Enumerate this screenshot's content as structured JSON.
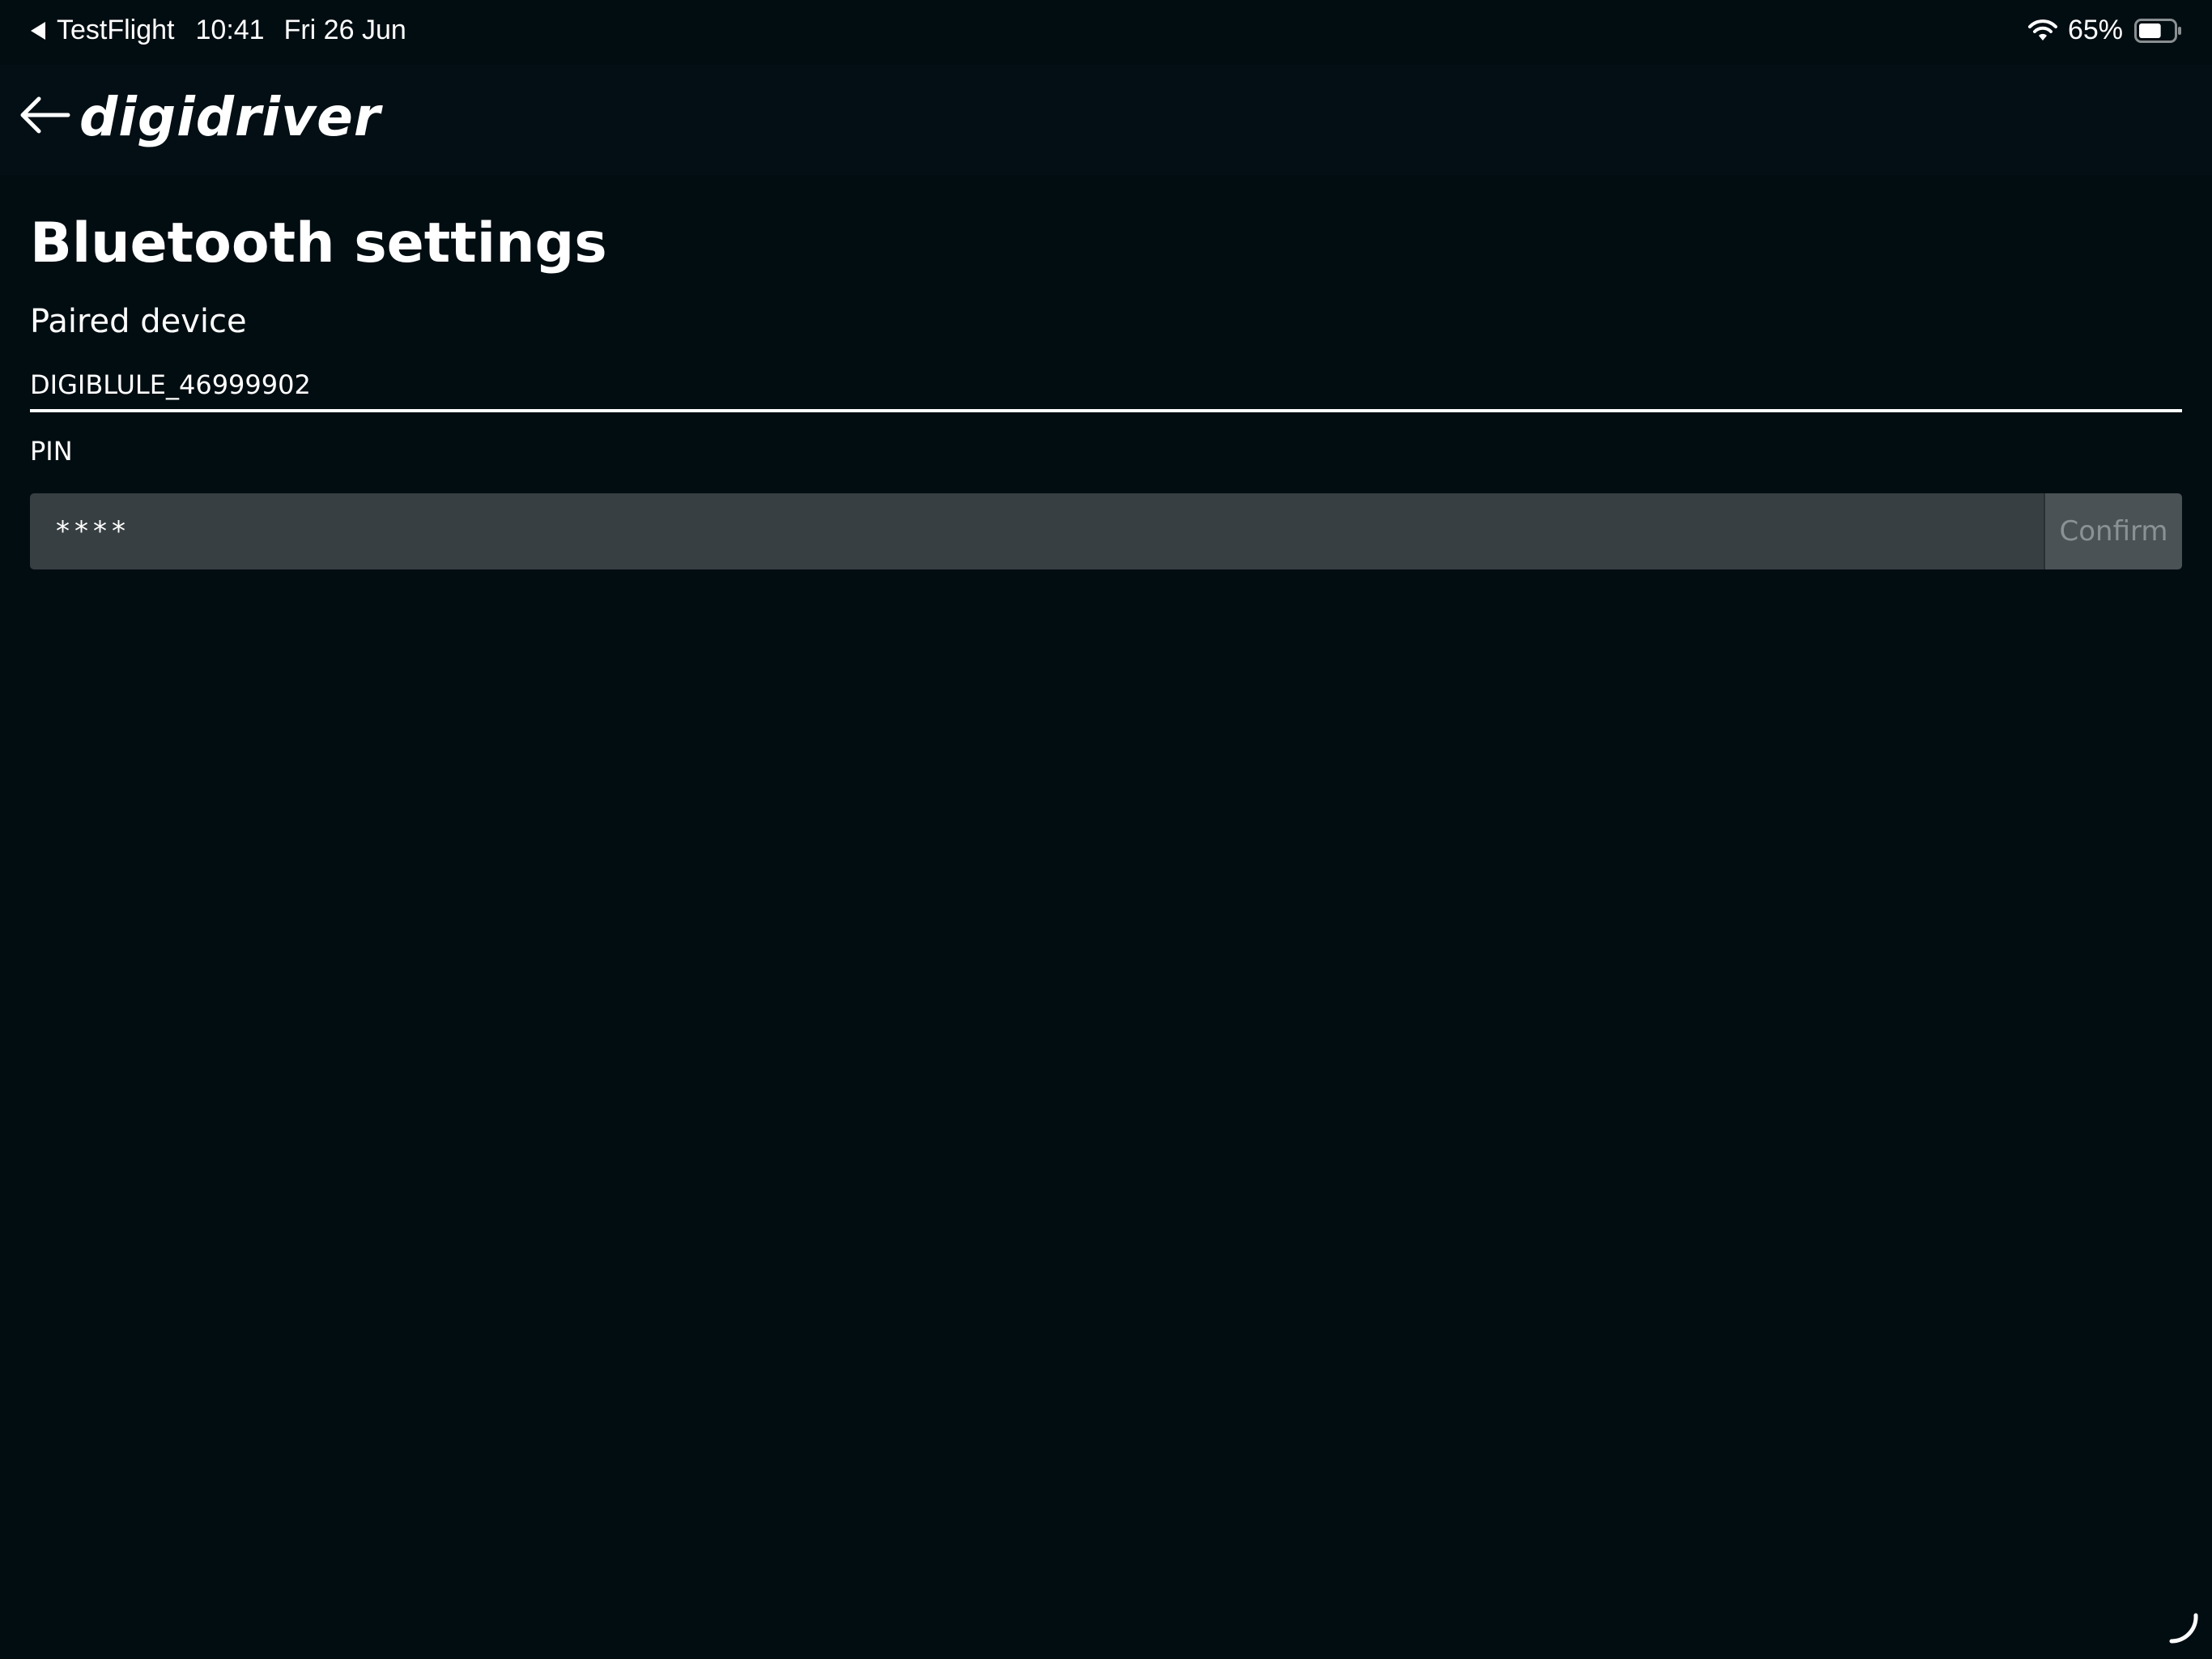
{
  "status_bar": {
    "back_app": "TestFlight",
    "time": "10:41",
    "date": "Fri 26 Jun",
    "battery_percent": "65%",
    "battery_level": 0.65
  },
  "header": {
    "logo_text": "digidriver",
    "back_icon": "arrow-left-icon"
  },
  "main": {
    "title": "Bluetooth settings",
    "paired_device_label": "Paired device",
    "paired_device_name": "DIGIBLULE_46999902",
    "pin_label": "PIN",
    "pin_value": "****",
    "confirm_label": "Confirm"
  },
  "colors": {
    "background": "#020d12",
    "input_background": "#373f42",
    "button_background": "#4a5255",
    "button_text": "#8a9295",
    "text": "#ffffff"
  }
}
